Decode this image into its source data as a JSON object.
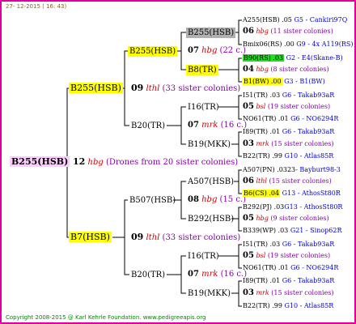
{
  "header": {
    "date": "27- 12-2015 ( 16: 43)"
  },
  "footer": {
    "copyright": "Copyright 2008-2015 @ Karl Kehrle Foundation.   www.pedigreeapis.org"
  },
  "root": {
    "label": "B255(HSB)",
    "num": "12",
    "code": "hbg",
    "desc": "(Drones from 20 sister colonies)"
  },
  "g1": [
    {
      "label": "B255(HSB)",
      "num": "09",
      "code": "lthl",
      "desc": "(33 sister colonies)"
    },
    {
      "label": "B7(HSB)",
      "num": "09",
      "code": "lthl",
      "desc": "(33 sister colonies)"
    }
  ],
  "g2": [
    {
      "label": "B255(HSB)",
      "num": "07",
      "code": "hbg",
      "desc": "(22 c.)"
    },
    {
      "label": "B20(TR)",
      "num": "07",
      "code": "mrk",
      "desc": "(16 c.)"
    },
    {
      "label": "B507(HSB)",
      "num": "08",
      "code": "hbg",
      "desc": "(15 c.)"
    },
    {
      "label": "B20(TR)",
      "num": "07",
      "code": "mrk",
      "desc": "(16 c.)"
    }
  ],
  "g3": [
    {
      "label": "B255(HSB)"
    },
    {
      "label": "B8(TR)"
    },
    {
      "label": "I16(TR)"
    },
    {
      "label": "B19(MKK)"
    },
    {
      "label": "A507(HSB)"
    },
    {
      "label": "B292(HSB)"
    },
    {
      "label": "I16(TR)"
    },
    {
      "label": "B19(MKK)"
    }
  ],
  "g4": [
    {
      "top": "A255(HSB) .05",
      "top_b": "G5 - Cankiri97Q",
      "num": "06",
      "code": "hbg",
      "desc": "(11 sister colonies)",
      "bot": "Bmix06(RS) .00",
      "bot_b": "G9 - 4x A119(RS)"
    },
    {
      "top": "B90(RS) .03",
      "top_b": "G2 - E4(Skane-B)",
      "num": "04",
      "code": "hbg",
      "desc": "(8 sister colonies)",
      "bot": "B1(BW) .00",
      "bot_b": "G3 - B1(BW)"
    },
    {
      "top": "I51(TR) .03",
      "top_b": "G6 - Takab93aR",
      "num": "05",
      "code": "bsl",
      "desc": "(19 sister colonies)",
      "bot": "NO61(TR) .01",
      "bot_b": "G6 - NO6294R"
    },
    {
      "top": "I89(TR) .01",
      "top_b": "G6 - Takab93aR",
      "num": "03",
      "code": "mrk",
      "desc": "(15 sister colonies)",
      "bot": "B22(TR) .99",
      "bot_b": "G10 - Atlas85R"
    },
    {
      "top": "A507(PN) .0323",
      "top_b": "- Bayburt98-3",
      "num": "06",
      "code": "lthl",
      "desc": "(15 sister colonies)",
      "bot": "B6(CS) .04",
      "bot_b": "G13 - AthosSt80R"
    },
    {
      "top": "B292(PJ) .03",
      "top_b": "G13 - AthosSt80R",
      "num": "05",
      "code": "hbg",
      "desc": "(9 sister colonies)",
      "bot": "B339(WP) .03",
      "bot_b": "G21 - Sinop62R"
    },
    {
      "top": "I51(TR) .03",
      "top_b": "G6 - Takab93aR",
      "num": "05",
      "code": "bsl",
      "desc": "(19 sister colonies)",
      "bot": "NO61(TR) .01",
      "bot_b": "G6 - NO6294R"
    },
    {
      "top": "I89(TR) .01",
      "top_b": "G6 - Takab93aR",
      "num": "03",
      "code": "mrk",
      "desc": "(15 sister colonies)",
      "bot": "B22(TR) .99",
      "bot_b": "G10 - Atlas85R"
    }
  ]
}
